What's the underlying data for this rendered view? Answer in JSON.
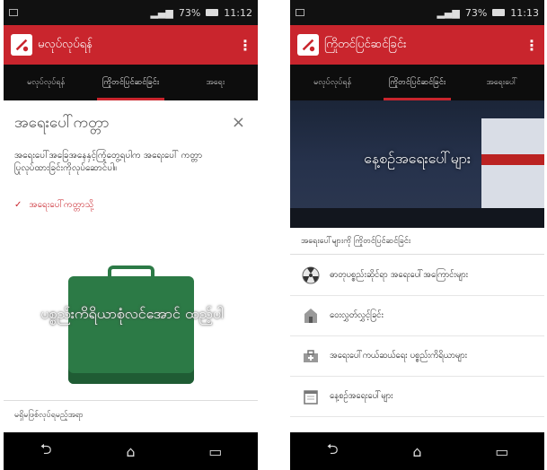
{
  "status_bar": {
    "battery_percent": "73%",
    "time_left": "11:12",
    "time_right": "11:13"
  },
  "left_screen": {
    "app_title": "မလုပ်လုပ်ရန်",
    "tabs": [
      "မလုပ်လုပ်ရန်",
      "ကြိုတင်ပြင်ဆင်ခြင်း",
      "အရေး"
    ],
    "card": {
      "title": "အရေးပေါ်ကတ္တာ",
      "close": "×",
      "description": "အရေးပေါ်အခြေအနေနှင့်ကြုံတွေ့ရပါက အရေးပေါ် ကတ္တာ ပြုလုပ်ထားခြင်းကိုလုပ်ဆောင်ပါ။",
      "link": "အရေးပေါ်ကတ္တာသို့",
      "kit_text": "ပစ္စည်းကိရိယာစုံလင်အောင် ထည့်ပါ",
      "footer": "မရှိမဖြစ်လုပ်ရမည့်အရာ"
    }
  },
  "right_screen": {
    "app_title": "ကြိုတင်ပြင်ဆင်ခြင်း",
    "tabs": [
      "မလုပ်လုပ်ရန်",
      "ကြိုတင်ပြင်ဆင်ခြင်း",
      "အရေးပေါ်"
    ],
    "hero_text": "နေ့စဉ်အရေးပေါ်များ",
    "section_header": "အရေးပေါ်များကို ကြိုတင်ပြင်ဆင်ခြင်း",
    "items": [
      {
        "label": "ဓာတုပစ္စည်းဆိုင်ရာ အရေးပေါ်အကြောင်းများ",
        "icon": "radiation-icon"
      },
      {
        "label": "ဝေးလွှတ်လွှင့်ခြင်း",
        "icon": "evacuation-icon"
      },
      {
        "label": "အရေးပေါ်ကယ်ဆယ်ရေး ပစ္စည်းကိရိယာများ",
        "icon": "rescue-kit-icon"
      },
      {
        "label": "နေ့စဉ်အရေးပေါ်များ",
        "icon": "calendar-icon"
      }
    ]
  },
  "nav": {
    "back": "⮌",
    "home": "⌂",
    "recents": "▭"
  },
  "colors": {
    "accent": "#c9252d",
    "tab_bg": "#0d0d0d",
    "status_bg": "#111111"
  }
}
